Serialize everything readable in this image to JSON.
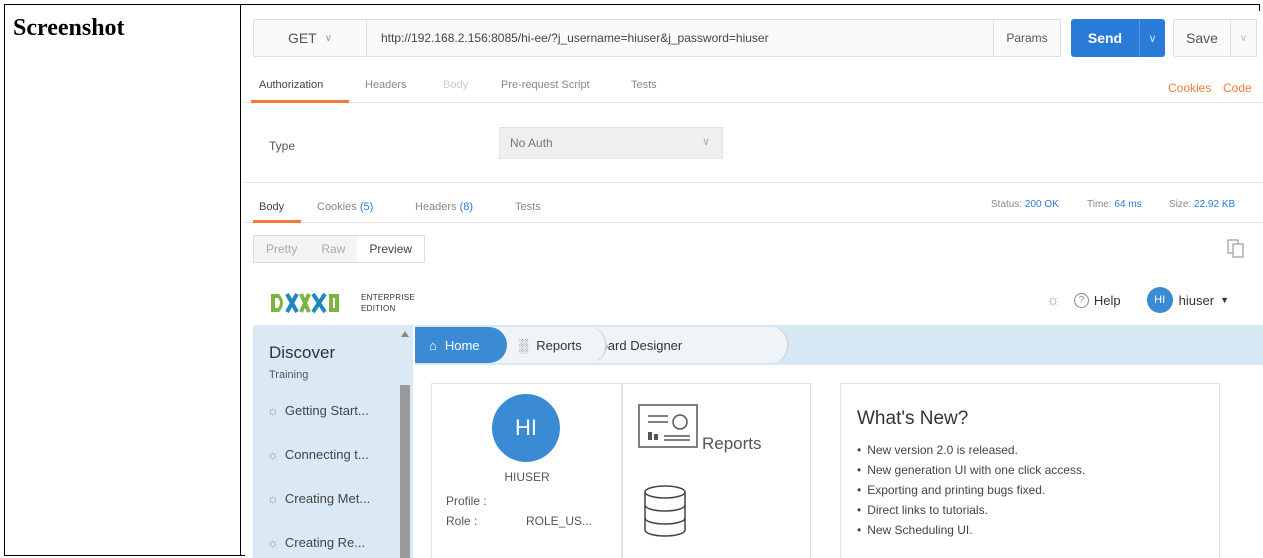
{
  "cell_label": "Screenshot",
  "request": {
    "method": "GET",
    "url": "http://192.168.2.156:8085/hi-ee/?j_username=hiuser&j_password=hiuser",
    "params_label": "Params",
    "send_label": "Send",
    "save_label": "Save"
  },
  "request_tabs": {
    "authorization": "Authorization",
    "headers": "Headers",
    "body": "Body",
    "prerequest": "Pre-request Script",
    "tests": "Tests",
    "cookies_link": "Cookies",
    "code_link": "Code"
  },
  "auth": {
    "type_label": "Type",
    "type_value": "No Auth"
  },
  "response_tabs": {
    "body": "Body",
    "cookies": "Cookies",
    "cookies_count": "(5)",
    "headers": "Headers",
    "headers_count": "(8)",
    "tests": "Tests"
  },
  "status": {
    "status_label": "Status:",
    "status_value": "200 OK",
    "time_label": "Time:",
    "time_value": "64 ms",
    "size_label": "Size:",
    "size_value": "22.92 KB"
  },
  "view_modes": {
    "pretty": "Pretty",
    "raw": "Raw",
    "preview": "Preview"
  },
  "app": {
    "logo_line1": "ENTERPRISE",
    "logo_line2": "EDITION",
    "help_label": "Help",
    "user_initials": "HI",
    "user_menu_label": "hiuser",
    "sidebar": {
      "title": "Discover",
      "subtitle": "Training",
      "items": [
        "Getting Start...",
        "Connecting t...",
        "Creating Met...",
        "Creating Re..."
      ]
    },
    "nav": {
      "home": "Home",
      "reports": "Reports",
      "designer": "Dashboard Designer"
    },
    "profile": {
      "initials": "HI",
      "name": "HIUSER",
      "profile_label": "Profile :",
      "role_label": "Role :",
      "role_value": "ROLE_US..."
    },
    "reports_card_label": "Reports",
    "whats_new": {
      "title": "What's New?",
      "items": [
        "New version 2.0 is released.",
        "New generation UI with one click access.",
        "Exporting and printing bugs fixed.",
        "Direct links to tutorials.",
        "New Scheduling UI."
      ]
    }
  },
  "colors": {
    "accent_blue": "#2a7ad8",
    "tab_orange": "#f07d3a",
    "sidebar_bg": "#dbe9f4"
  }
}
